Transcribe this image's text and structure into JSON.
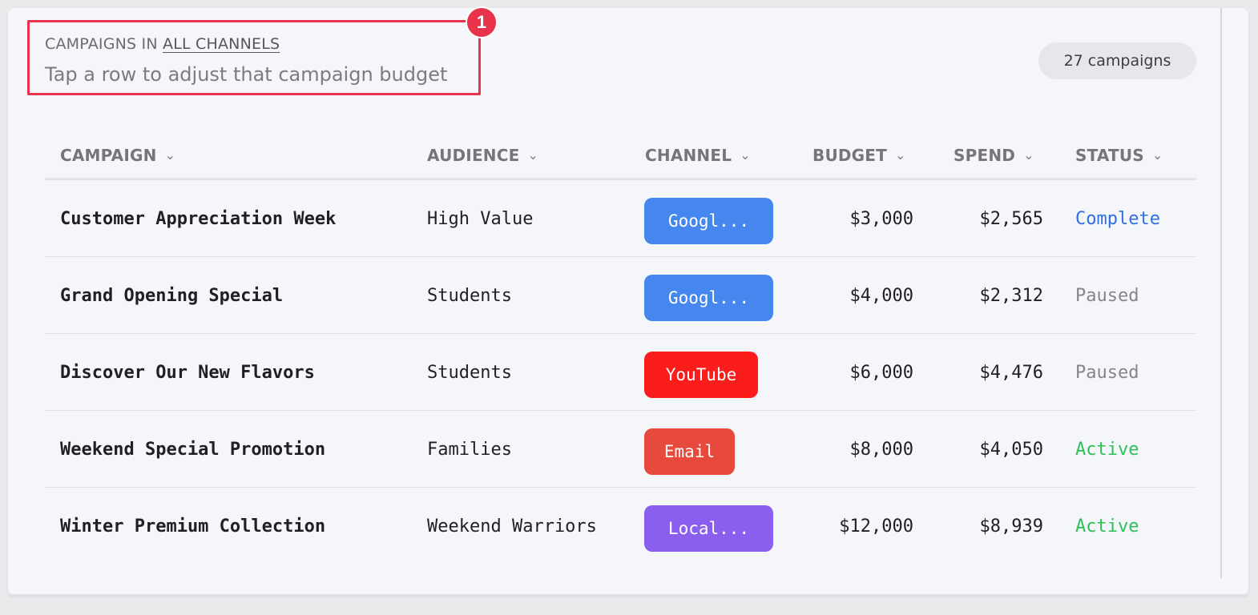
{
  "header": {
    "label_prefix": "CAMPAIGNS IN ",
    "label_link": "ALL CHANNELS",
    "subtitle": "Tap a row to adjust that campaign budget",
    "count": "27 campaigns"
  },
  "annotation": {
    "number": "1",
    "color": "#e8344a"
  },
  "table": {
    "columns": [
      {
        "label": "CAMPAIGN",
        "icon": "chevron-down-icon"
      },
      {
        "label": "AUDIENCE",
        "icon": "chevron-down-icon"
      },
      {
        "label": "CHANNEL",
        "icon": "chevron-down-icon"
      },
      {
        "label": "BUDGET",
        "icon": "chevron-down-icon"
      },
      {
        "label": "SPEND",
        "icon": "chevron-down-icon"
      },
      {
        "label": "STATUS",
        "icon": "chevron-down-icon"
      }
    ],
    "rows": [
      {
        "campaign": "Customer Appreciation Week",
        "audience": "High Value",
        "channel": "Googl...",
        "channel_color": "#4586ef",
        "budget": "$3,000",
        "spend": "$2,565",
        "status": "Complete",
        "status_color": "#2f6fe0"
      },
      {
        "campaign": "Grand Opening Special",
        "audience": "Students",
        "channel": "Googl...",
        "channel_color": "#4586ef",
        "budget": "$4,000",
        "spend": "$2,312",
        "status": "Paused",
        "status_color": "#85858c"
      },
      {
        "campaign": "Discover Our New Flavors",
        "audience": "Students",
        "channel": "YouTube",
        "channel_color": "#fb1c1c",
        "budget": "$6,000",
        "spend": "$4,476",
        "status": "Paused",
        "status_color": "#85858c"
      },
      {
        "campaign": "Weekend Special Promotion",
        "audience": "Families",
        "channel": "Email",
        "channel_color": "#e7493d",
        "budget": "$8,000",
        "spend": "$4,050",
        "status": "Active",
        "status_color": "#2dbf58"
      },
      {
        "campaign": "Winter Premium Collection",
        "audience": "Weekend Warriors",
        "channel": "Local...",
        "channel_color": "#8a5ff0",
        "budget": "$12,000",
        "spend": "$8,939",
        "status": "Active",
        "status_color": "#2dbf58"
      }
    ]
  }
}
